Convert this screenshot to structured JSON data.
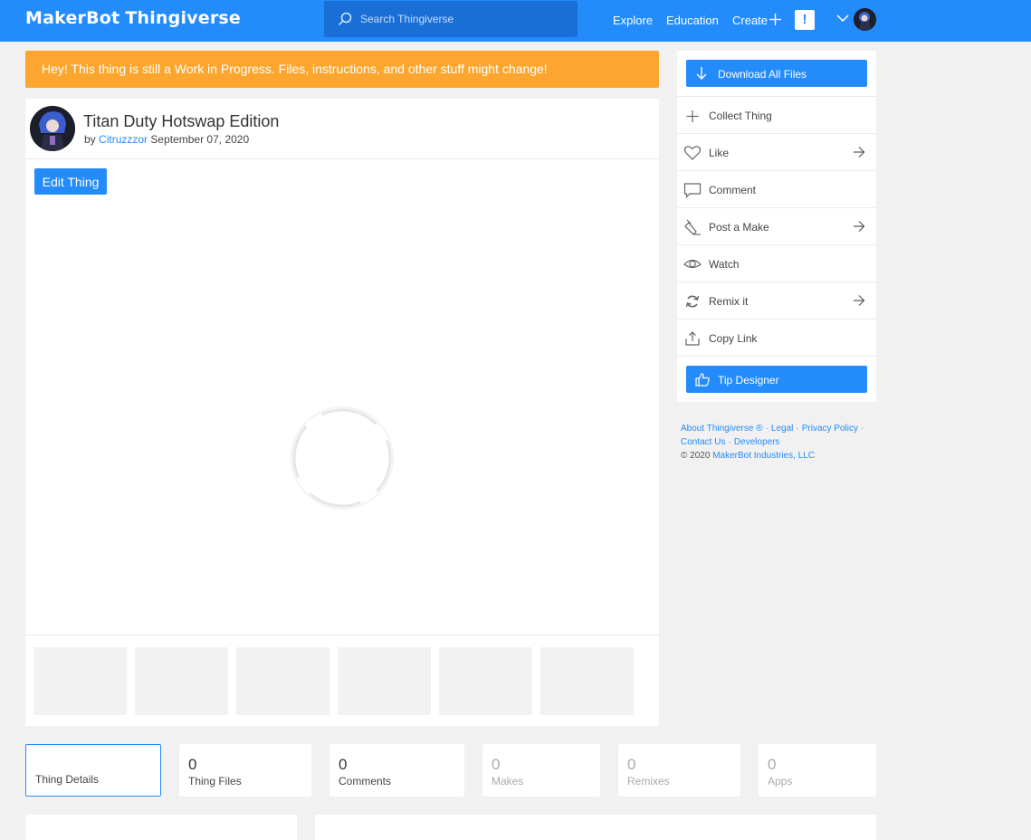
{
  "header": {
    "logo_part1": "MakerBot",
    "logo_part2": "Thingiverse",
    "search_placeholder": "Search Thingiverse",
    "nav": [
      "Explore",
      "Education",
      "Create"
    ],
    "alert_glyph": "!"
  },
  "banner": {
    "text": "Hey! This thing is still a Work in Progress. Files, instructions, and other stuff might change!"
  },
  "thing": {
    "title": "Titan Duty Hotswap Edition",
    "by": "by",
    "author": "Citruzzzor",
    "date": "September 07, 2020",
    "edit_label": "Edit Thing"
  },
  "sidebar": {
    "download_label": "Download All Files",
    "actions": [
      {
        "label": "Collect Thing",
        "icon": "plus-icon",
        "arrow": false
      },
      {
        "label": "Like",
        "icon": "heart-icon",
        "arrow": true
      },
      {
        "label": "Comment",
        "icon": "comment-icon",
        "arrow": false
      },
      {
        "label": "Post a Make",
        "icon": "pencil-icon",
        "arrow": true
      },
      {
        "label": "Watch",
        "icon": "eye-icon",
        "arrow": false
      },
      {
        "label": "Remix it",
        "icon": "remix-icon",
        "arrow": true
      },
      {
        "label": "Copy Link",
        "icon": "share-icon",
        "arrow": false
      }
    ],
    "tip_label": "Tip Designer"
  },
  "footer": {
    "about": "About Thingiverse ®",
    "legal": "Legal",
    "privacy": "Privacy Policy",
    "contact": "Contact Us",
    "developers": "Developers",
    "copyright": "©  2020",
    "company": "MakerBot Industries, LLC"
  },
  "tabs": [
    {
      "count": "",
      "label": "Thing Details",
      "active": true
    },
    {
      "count": "0",
      "label": "Thing Files"
    },
    {
      "count": "0",
      "label": "Comments"
    },
    {
      "count": "0",
      "label": "Makes",
      "muted": true
    },
    {
      "count": "0",
      "label": "Remixes",
      "muted": true
    },
    {
      "count": "0",
      "label": "Apps",
      "muted": true
    }
  ],
  "colors": {
    "brand": "#248bfb",
    "banner": "#fda62f",
    "background": "#f1f1f1"
  }
}
